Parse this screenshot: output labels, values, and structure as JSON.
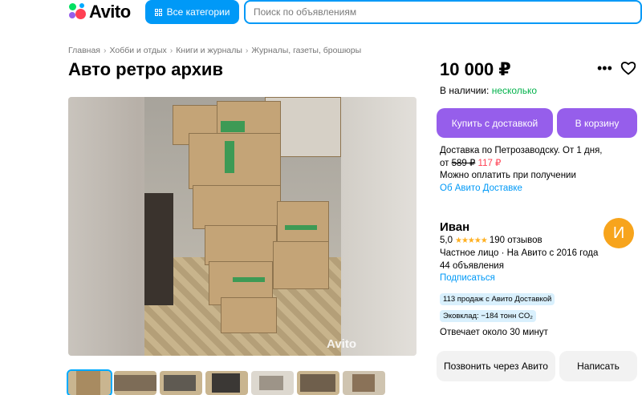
{
  "header": {
    "logo_text": "Avito",
    "categories_label": "Все категории",
    "search_placeholder": "Поиск по объявлениям"
  },
  "breadcrumbs": [
    "Главная",
    "Хобби и отдых",
    "Книги и журналы",
    "Журналы, газеты, брошюры"
  ],
  "listing": {
    "title": "Авто ретро архив",
    "photo_watermark": "Avito",
    "thumbnail_count": 7
  },
  "sidebar": {
    "price": "10 000 ₽",
    "stock_label": "В наличии:",
    "stock_value": "несколько",
    "buy_button": "Купить с доставкой",
    "cart_button": "В корзину",
    "delivery_line1": "Доставка по Петрозаводску. От 1 дня,",
    "delivery_from": "от",
    "delivery_old_price": "589 ₽",
    "delivery_new_price": "117 ₽",
    "pay_on_receipt": "Можно оплатить при получении",
    "delivery_link": "Об Авито Доставке"
  },
  "seller": {
    "name": "Иван",
    "avatar_letter": "И",
    "rating": "5,0",
    "reviews": "190 отзывов",
    "info": "Частное лицо · На Авито с 2016 года",
    "ads": "44 объявления",
    "subscribe": "Подписаться",
    "badge_sales": "113 продаж с Авито Доставкой",
    "badge_eco": "Эковклад: −184 тонн CO₂",
    "reply_time": "Отвечает около 30 минут",
    "call_button": "Позвонить через Авито",
    "message_button": "Написать"
  },
  "colors": {
    "accent_blue": "#0099f7",
    "purple": "#965eeb",
    "green": "#02b24b",
    "red": "#ff4053"
  }
}
